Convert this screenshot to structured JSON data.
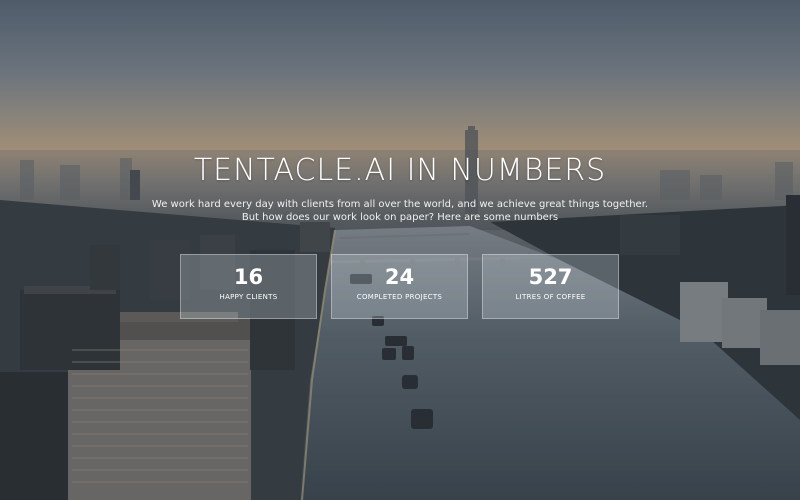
{
  "hero": {
    "title": "TENTACLE.AI IN NUMBERS",
    "subtitle_line1": "We work hard every day with clients from all over the world, and we achieve great things together.",
    "subtitle_line2": "But how does our work look on paper? Here are some numbers"
  },
  "stats": [
    {
      "value": "16",
      "label": "HAPPY CLIENTS"
    },
    {
      "value": "24",
      "label": "COMPLETED PROJECTS"
    },
    {
      "value": "527",
      "label": "LITRES OF COFFEE"
    }
  ],
  "colors": {
    "text": "#ffffff",
    "box_fill": "rgba(210,218,226,0.28)",
    "sky_warm": "#c4a888",
    "river": "#4a5862"
  }
}
